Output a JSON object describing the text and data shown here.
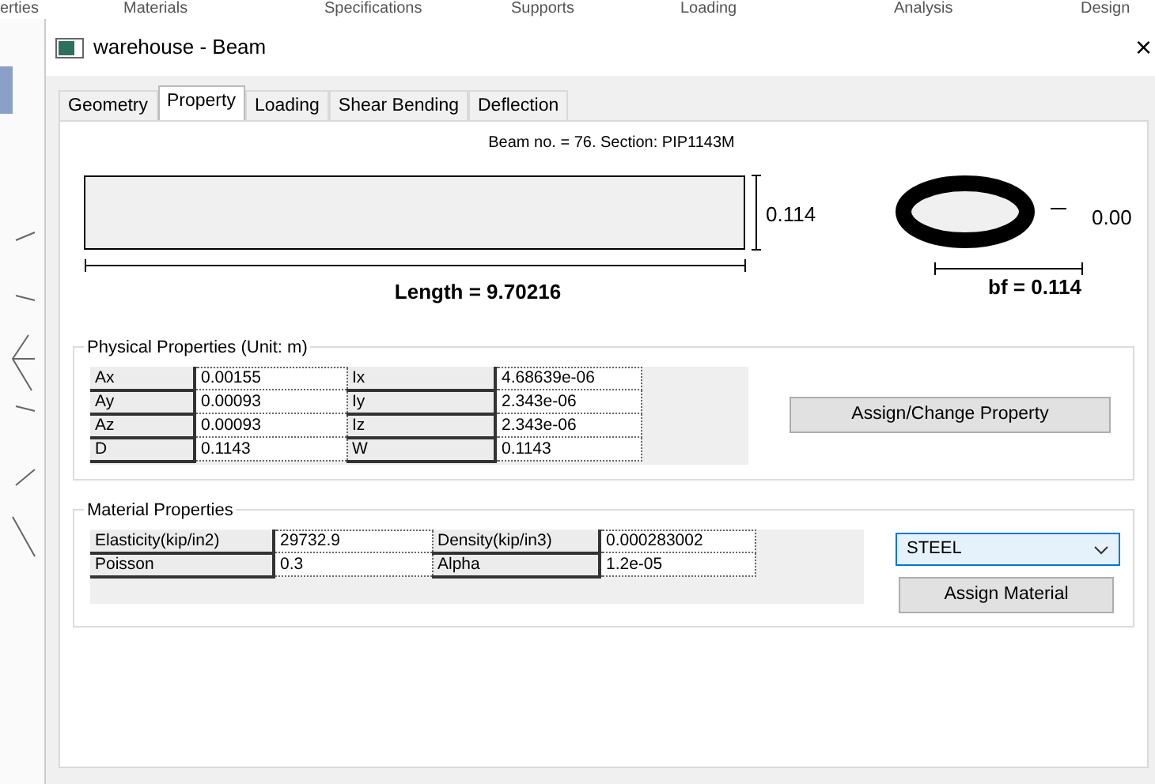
{
  "background_menu": [
    "erties",
    "Materials",
    "Specifications",
    "Supports",
    "Loading",
    "Analysis",
    "Design"
  ],
  "window": {
    "title": "warehouse - Beam",
    "close": "×"
  },
  "tabs": [
    {
      "label": "Geometry",
      "selected": false
    },
    {
      "label": "Property",
      "selected": true
    },
    {
      "label": "Loading",
      "selected": false
    },
    {
      "label": "Shear Bending",
      "selected": false
    },
    {
      "label": "Deflection",
      "selected": false
    }
  ],
  "beam": {
    "caption": "Beam no. = 76. Section: PIP1143M",
    "depth_label": "0.114",
    "length_label": "Length = 9.70216",
    "thickness_label": "0.00",
    "bf_label": "bf = 0.114"
  },
  "physical_properties": {
    "title": "Physical Properties (Unit: m)",
    "rows": [
      {
        "name": "Ax",
        "value": "0.00155",
        "name_2": "Ix",
        "value_2": "4.68639e-06"
      },
      {
        "name": "Ay",
        "value": "0.00093",
        "name_2": "Iy",
        "value_2": "2.343e-06"
      },
      {
        "name": "Az",
        "value": "0.00093",
        "name_2": "Iz",
        "value_2": "2.343e-06"
      },
      {
        "name": "D",
        "value": "0.1143",
        "name_2": "W",
        "value_2": "0.1143"
      }
    ],
    "button": "Assign/Change Property"
  },
  "material_properties": {
    "title": "Material Properties",
    "rows": [
      {
        "name": "Elasticity(kip/in2)",
        "value": "29732.9",
        "name_2": "Density(kip/in3)",
        "value_2": "0.000283002"
      },
      {
        "name": "Poisson",
        "value": "0.3",
        "name_2": "Alpha",
        "value_2": "1.2e-05"
      }
    ],
    "material": "STEEL",
    "button": "Assign Material"
  }
}
